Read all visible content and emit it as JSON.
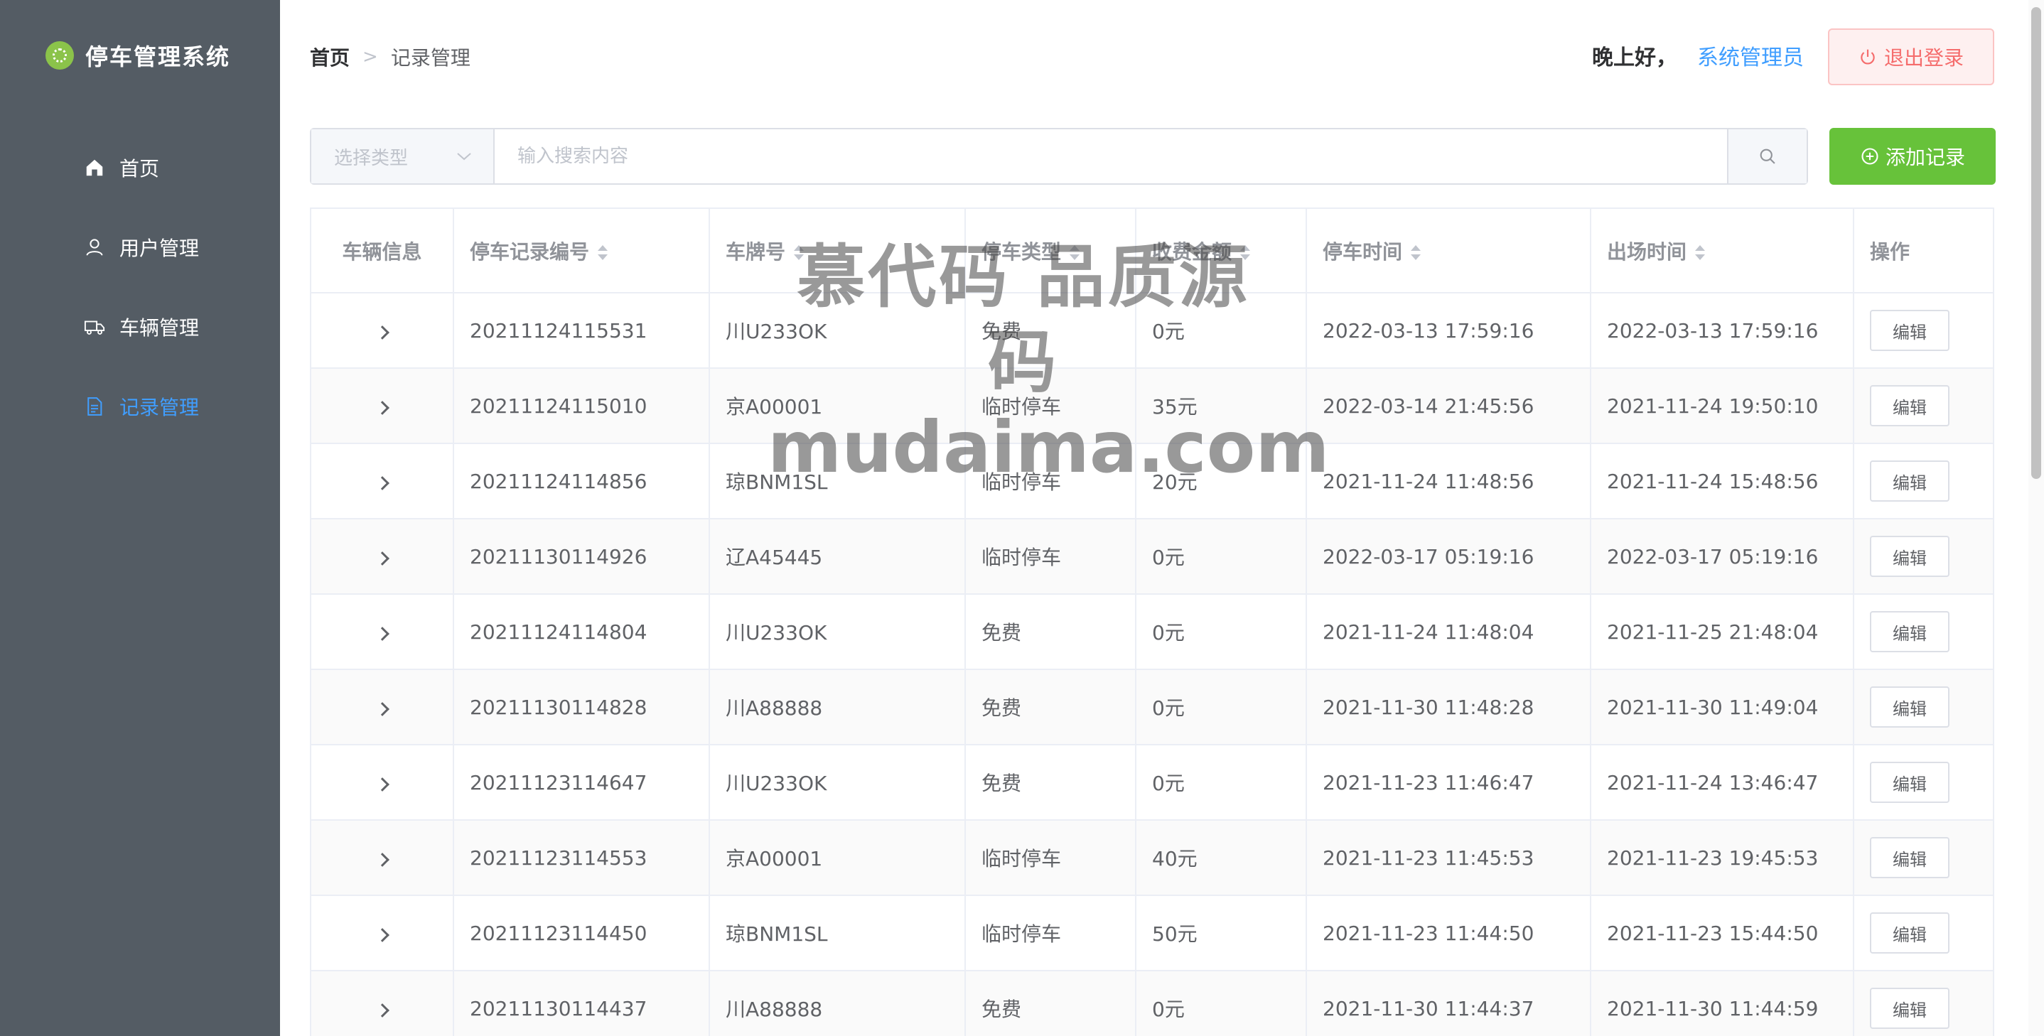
{
  "sidebar": {
    "brand": "停车管理系统",
    "items": [
      {
        "label": "首页",
        "icon": "house-icon",
        "active": false
      },
      {
        "label": "用户管理",
        "icon": "user-icon",
        "active": false
      },
      {
        "label": "车辆管理",
        "icon": "truck-icon",
        "active": false
      },
      {
        "label": "记录管理",
        "icon": "document-icon",
        "active": true
      }
    ]
  },
  "header": {
    "breadcrumb": {
      "home": "首页",
      "current": "记录管理"
    },
    "greeting": "晚上好，",
    "username": "系统管理员",
    "logout_label": "退出登录"
  },
  "toolbar": {
    "type_placeholder": "选择类型",
    "search_placeholder": "输入搜索内容",
    "add_label": "添加记录"
  },
  "table": {
    "columns": [
      "车辆信息",
      "停车记录编号",
      "车牌号",
      "停车类型",
      "收费金额",
      "停车时间",
      "出场时间",
      "操作"
    ],
    "edit_label": "编辑",
    "rows": [
      {
        "id": "20211124115531",
        "plate": "川U233OK",
        "type": "免费",
        "fee": "0元",
        "start": "2022-03-13 17:59:16",
        "end": "2022-03-13 17:59:16"
      },
      {
        "id": "20211124115010",
        "plate": "京A00001",
        "type": "临时停车",
        "fee": "35元",
        "start": "2022-03-14 21:45:56",
        "end": "2021-11-24 19:50:10"
      },
      {
        "id": "20211124114856",
        "plate": "琼BNM1SL",
        "type": "临时停车",
        "fee": "20元",
        "start": "2021-11-24 11:48:56",
        "end": "2021-11-24 15:48:56"
      },
      {
        "id": "20211130114926",
        "plate": "辽A45445",
        "type": "临时停车",
        "fee": "0元",
        "start": "2022-03-17 05:19:16",
        "end": "2022-03-17 05:19:16"
      },
      {
        "id": "20211124114804",
        "plate": "川U233OK",
        "type": "免费",
        "fee": "0元",
        "start": "2021-11-24 11:48:04",
        "end": "2021-11-25 21:48:04"
      },
      {
        "id": "20211130114828",
        "plate": "川A88888",
        "type": "免费",
        "fee": "0元",
        "start": "2021-11-30 11:48:28",
        "end": "2021-11-30 11:49:04"
      },
      {
        "id": "20211123114647",
        "plate": "川U233OK",
        "type": "免费",
        "fee": "0元",
        "start": "2021-11-23 11:46:47",
        "end": "2021-11-24 13:46:47"
      },
      {
        "id": "20211123114553",
        "plate": "京A00001",
        "type": "临时停车",
        "fee": "40元",
        "start": "2021-11-23 11:45:53",
        "end": "2021-11-23 19:45:53"
      },
      {
        "id": "20211123114450",
        "plate": "琼BNM1SL",
        "type": "临时停车",
        "fee": "50元",
        "start": "2021-11-23 11:44:50",
        "end": "2021-11-23 15:44:50"
      },
      {
        "id": "20211130114437",
        "plate": "川A88888",
        "type": "免费",
        "fee": "0元",
        "start": "2021-11-30 11:44:37",
        "end": "2021-11-30 11:44:59"
      }
    ]
  },
  "watermark": {
    "line1": "慕代码 品质源码",
    "line2": "mudaima.com"
  },
  "colors": {
    "sidebar": "#545c64",
    "accent": "#409eff",
    "add": "#67c23a",
    "danger": "#f56c6c"
  }
}
